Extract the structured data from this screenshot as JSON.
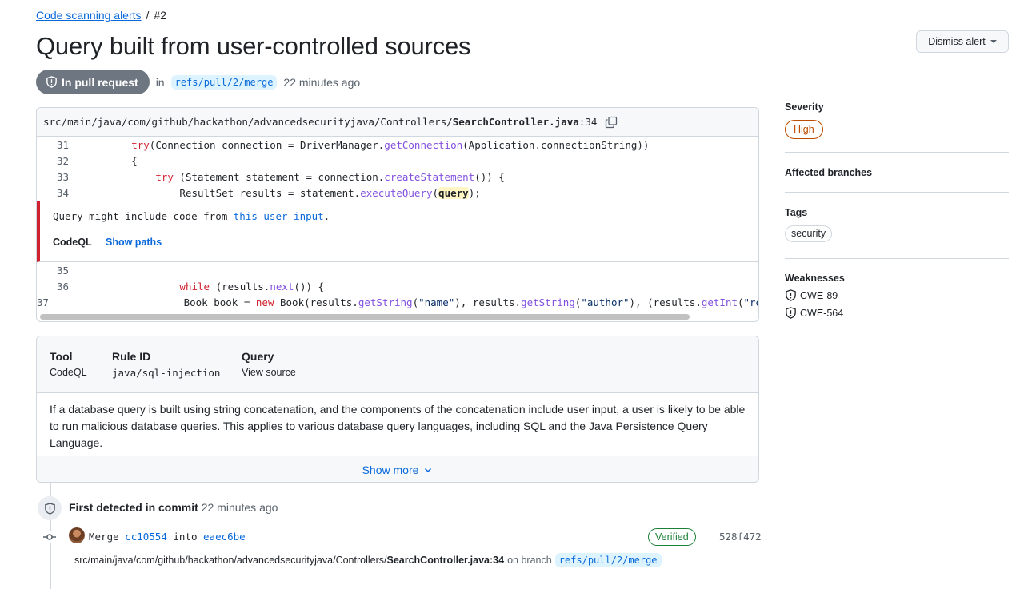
{
  "breadcrumb": {
    "parent": "Code scanning alerts",
    "separator": "/",
    "current": "#2"
  },
  "title": "Query built from user-controlled sources",
  "actions": {
    "dismiss_label": "Dismiss alert"
  },
  "state": {
    "label": "In pull request",
    "in_text": "in",
    "branch": "refs/pull/2/merge",
    "time": "22 minutes ago"
  },
  "code": {
    "file_path": "src/main/java/com/github/hackathon/advancedsecurityjava/Controllers/",
    "file_name": "SearchController.java",
    "line_suffix": ":34",
    "lines_before": [
      {
        "num": "31",
        "indent": "    ",
        "parts": [
          {
            "t": "try",
            "c": "kw"
          },
          {
            "t": "(Connection connection = DriverManager.",
            "c": ""
          },
          {
            "t": "getConnection",
            "c": "fn"
          },
          {
            "t": "(Application.connectionString))",
            "c": ""
          }
        ]
      },
      {
        "num": "32",
        "indent": "    ",
        "parts": [
          {
            "t": "{",
            "c": ""
          }
        ]
      },
      {
        "num": "33",
        "indent": "        ",
        "parts": [
          {
            "t": "try",
            "c": "kw"
          },
          {
            "t": " (Statement statement = connection.",
            "c": ""
          },
          {
            "t": "createStatement",
            "c": "fn"
          },
          {
            "t": "()) {",
            "c": ""
          }
        ]
      },
      {
        "num": "34",
        "indent": "            ",
        "parts": [
          {
            "t": "ResultSet results = statement.",
            "c": ""
          },
          {
            "t": "executeQuery",
            "c": "fn"
          },
          {
            "t": "(",
            "c": ""
          },
          {
            "t": "query",
            "c": "hl"
          },
          {
            "t": ");",
            "c": ""
          }
        ]
      }
    ],
    "lines_after": [
      {
        "num": "35",
        "indent": "",
        "parts": []
      },
      {
        "num": "36",
        "indent": "            ",
        "parts": [
          {
            "t": "while",
            "c": "kw"
          },
          {
            "t": " (results.",
            "c": ""
          },
          {
            "t": "next",
            "c": "fn"
          },
          {
            "t": "()) {",
            "c": ""
          }
        ]
      },
      {
        "num": "37",
        "indent": "                ",
        "parts": [
          {
            "t": "Book book = ",
            "c": ""
          },
          {
            "t": "new",
            "c": "kw"
          },
          {
            "t": " Book(results.",
            "c": ""
          },
          {
            "t": "getString",
            "c": "fn"
          },
          {
            "t": "(",
            "c": ""
          },
          {
            "t": "\"name\"",
            "c": "str"
          },
          {
            "t": "), results.",
            "c": ""
          },
          {
            "t": "getString",
            "c": "fn"
          },
          {
            "t": "(",
            "c": ""
          },
          {
            "t": "\"author\"",
            "c": "str"
          },
          {
            "t": "), (results.",
            "c": ""
          },
          {
            "t": "getInt",
            "c": "fn"
          },
          {
            "t": "(",
            "c": ""
          },
          {
            "t": "\"rea",
            "c": "str"
          }
        ]
      }
    ],
    "alert": {
      "message_prefix": "Query might include code from ",
      "message_link": "this user input",
      "message_suffix": ".",
      "tool": "CodeQL",
      "show_paths": "Show paths"
    }
  },
  "rule": {
    "tool_label": "Tool",
    "tool_value": "CodeQL",
    "rule_id_label": "Rule ID",
    "rule_id_value": "java/sql-injection",
    "query_label": "Query",
    "query_value": "View source",
    "description": "If a database query is built using string concatenation, and the components of the concatenation include user input, a user is likely to be able to run malicious database queries. This applies to various database query languages, including SQL and the Java Persistence Query Language.",
    "show_more": "Show more"
  },
  "timeline": {
    "first_detected_bold": "First detected in commit",
    "first_detected_time": "22 minutes ago",
    "commit": {
      "merge_word": "Merge",
      "from_sha": "cc10554",
      "into_word": "into",
      "to_sha": "eaec6be",
      "verified": "Verified",
      "sha": "528f472",
      "loc_path": "src/main/java/com/github/hackathon/advancedsecurityjava/Controllers/",
      "loc_file": "SearchController.java:34",
      "on_branch": "on branch",
      "branch": "refs/pull/2/merge"
    }
  },
  "sidebar": {
    "severity_label": "Severity",
    "severity_value": "High",
    "branches_label": "Affected branches",
    "tags_label": "Tags",
    "tags": [
      "security"
    ],
    "weaknesses_label": "Weaknesses",
    "weaknesses": [
      "CWE-89",
      "CWE-564"
    ]
  },
  "colors": {
    "accent": "#0969da",
    "danger": "#cf222e",
    "severity": "#bc4c00",
    "success": "#1a7f37",
    "keyword": "#cf222e",
    "function": "#8250df",
    "string": "#0a3069"
  }
}
